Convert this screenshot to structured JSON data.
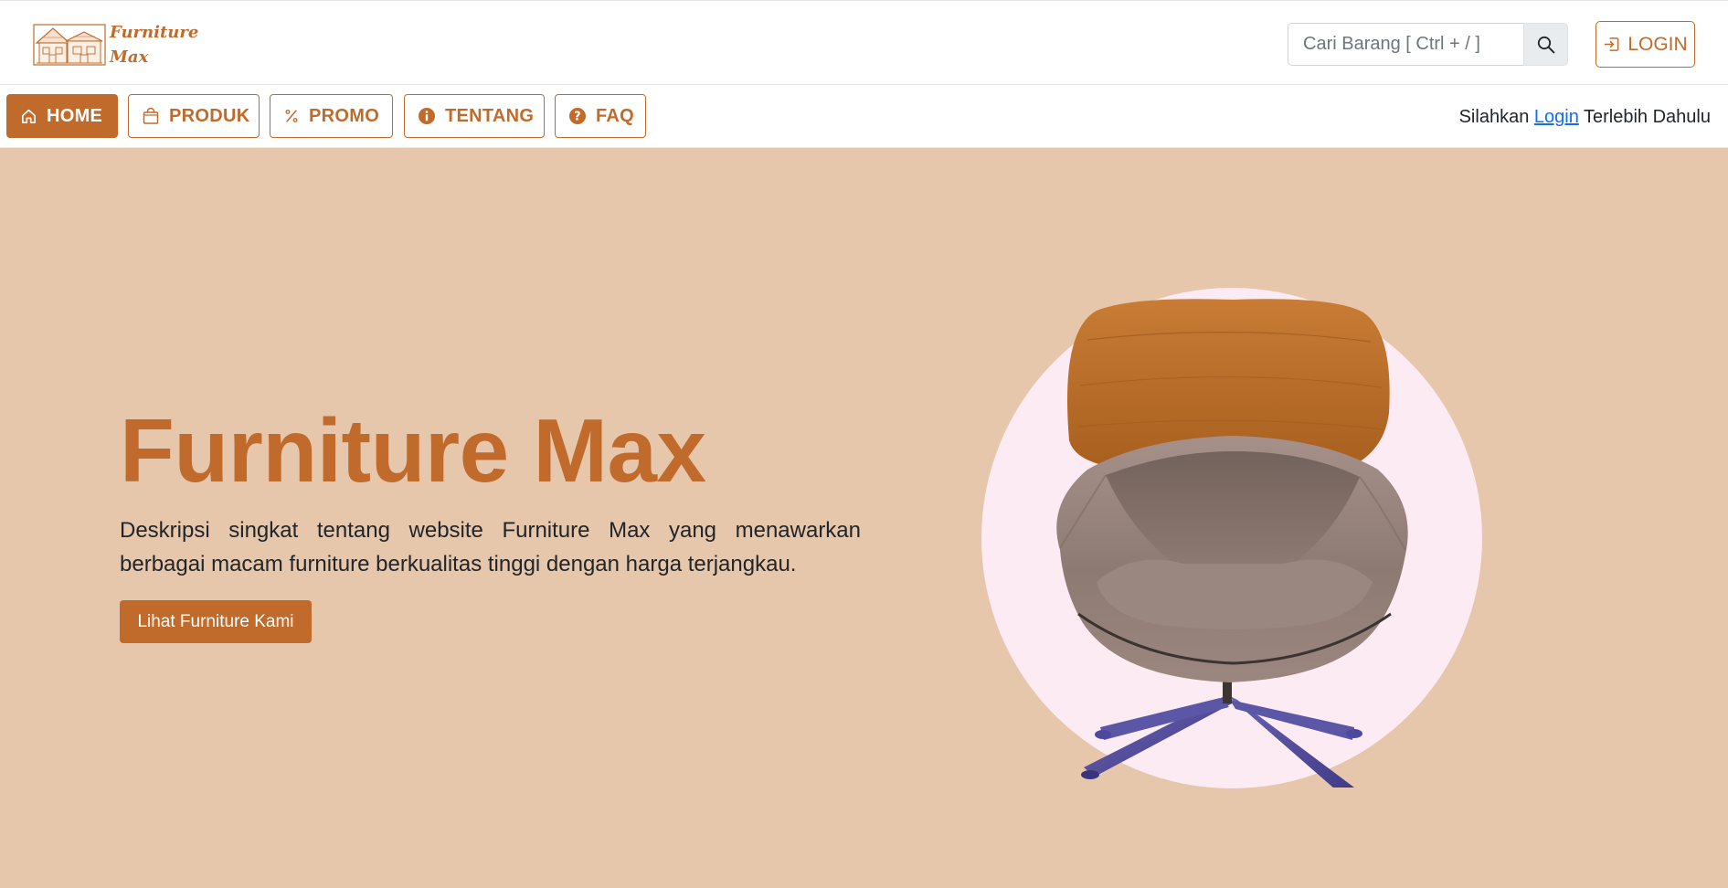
{
  "header": {
    "logo": {
      "line1": "Furniture",
      "line2": "Max",
      "icon": "house-logo-icon"
    },
    "search": {
      "placeholder": "Cari Barang [ Ctrl + / ]",
      "value": "",
      "icon": "search-icon"
    },
    "login_button": {
      "label": "LOGIN",
      "icon": "login-arrow-icon"
    }
  },
  "nav": {
    "items": [
      {
        "label": "HOME",
        "icon": "home-icon",
        "active": true
      },
      {
        "label": "PRODUK",
        "icon": "shopping-bag-icon",
        "active": false
      },
      {
        "label": "PROMO",
        "icon": "percent-icon",
        "active": false
      },
      {
        "label": "TENTANG",
        "icon": "info-icon",
        "active": false
      },
      {
        "label": "FAQ",
        "icon": "question-icon",
        "active": false
      }
    ],
    "login_note": {
      "before": "Silahkan",
      "link": "Login",
      "after": "Terlebih Dahulu"
    }
  },
  "hero": {
    "title": "Furniture Max",
    "description": "Deskripsi singkat tentang website Furniture Max yang menawarkan berbagai macam furniture berkualitas tinggi dengan harga terjangkau.",
    "cta_label": "Lihat Furniture Kami",
    "image": "lounge-chair-image"
  },
  "colors": {
    "brand": "#c06b2c",
    "hero_background": "#e6c7ac",
    "circle": "#fcebf2",
    "link": "#0d6efd"
  }
}
